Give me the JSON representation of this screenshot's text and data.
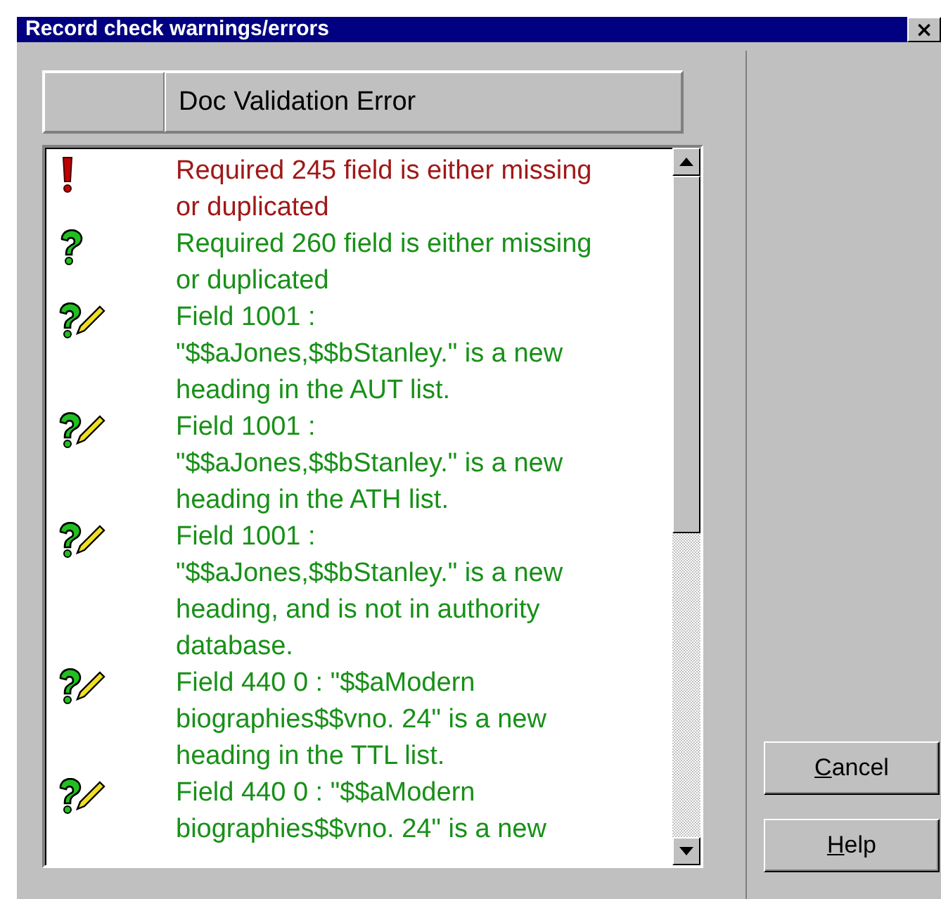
{
  "window": {
    "title": "Record check warnings/errors",
    "close": "×"
  },
  "header": {
    "label": "Doc Validation Error"
  },
  "messages": [
    {
      "kind": "error",
      "lines": [
        "Required 245 field is either missing",
        "or duplicated"
      ]
    },
    {
      "kind": "warning",
      "lines": [
        "Required 260 field is either missing",
        "or duplicated"
      ]
    },
    {
      "kind": "new-heading",
      "lines": [
        "Field 1001 :",
        "\"$$aJones,$$bStanley.\" is a new",
        "heading in the AUT list."
      ]
    },
    {
      "kind": "new-heading",
      "lines": [
        "Field 1001 :",
        "\"$$aJones,$$bStanley.\" is a new",
        "heading in the ATH list."
      ]
    },
    {
      "kind": "new-heading",
      "lines": [
        "Field 1001 :",
        "\"$$aJones,$$bStanley.\" is a new",
        "heading, and is not in authority",
        "database."
      ]
    },
    {
      "kind": "new-heading",
      "lines": [
        "Field 440 0 : \"$$aModern",
        "biographies$$vno. 24\" is a new",
        "heading in the TTL list."
      ]
    },
    {
      "kind": "new-heading",
      "lines": [
        "Field 440 0 : \"$$aModern",
        "biographies$$vno. 24\" is a new"
      ]
    }
  ],
  "buttons": [
    {
      "label": "Cancel"
    },
    {
      "label": "Help"
    }
  ]
}
